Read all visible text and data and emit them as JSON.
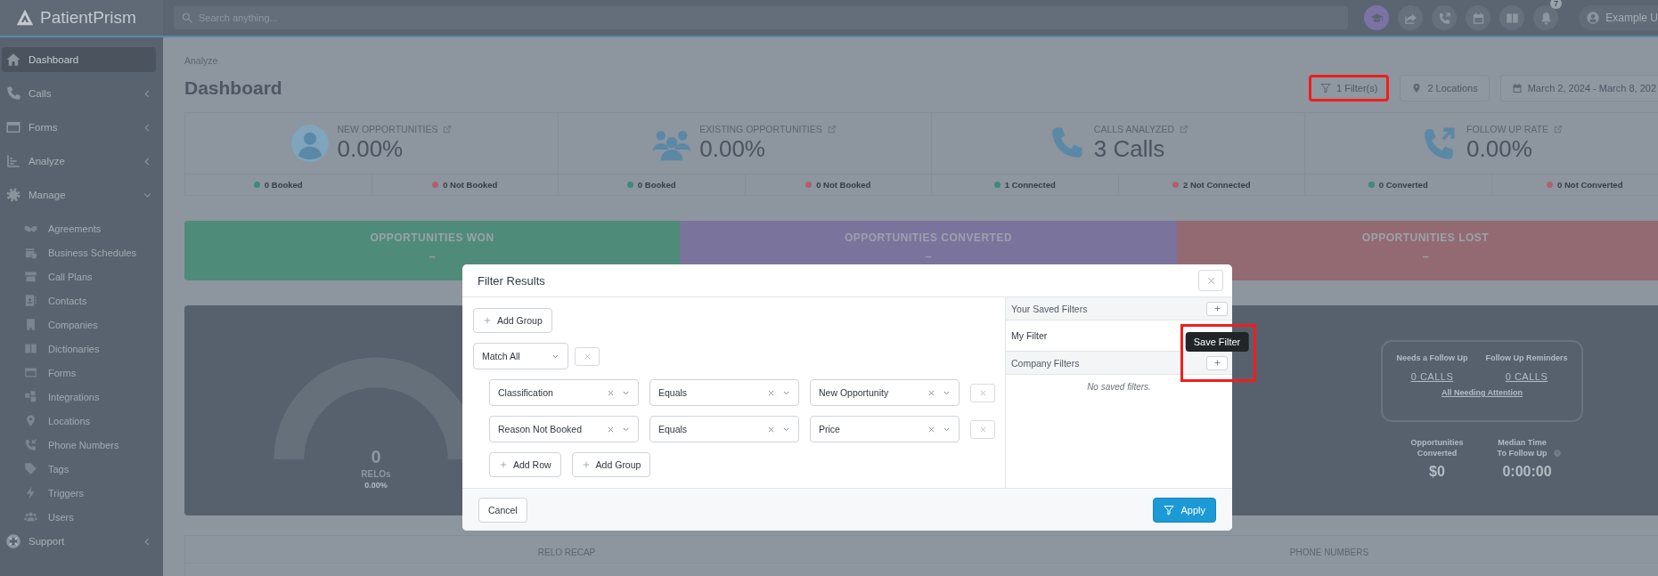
{
  "logo": "**Patient**Prism",
  "top_bar": {
    "search_placeholder": "Search anything...",
    "notification_count": "7",
    "user": "Example U"
  },
  "sidebar": {
    "items": [
      {
        "label": "Dashboard",
        "selected": true
      },
      {
        "label": "Calls",
        "selected": false,
        "expanded": false
      },
      {
        "label": "Forms",
        "selected": false,
        "expanded": false
      },
      {
        "label": "Analyze",
        "selected": false,
        "expanded": false
      },
      {
        "label": "Manage",
        "selected": false,
        "expanded": true,
        "children": [
          {
            "label": "Agreements",
            "selected": false
          },
          {
            "label": "Business Schedules",
            "selected": false
          },
          {
            "label": "Call Plans",
            "selected": false
          },
          {
            "label": "Contacts",
            "selected": false
          },
          {
            "label": "Companies",
            "selected": false
          },
          {
            "label": "Dictionaries",
            "selected": false
          },
          {
            "label": "Forms",
            "selected": false
          },
          {
            "label": "Integrations",
            "selected": false
          },
          {
            "label": "Locations",
            "selected": false
          },
          {
            "label": "Phone Numbers",
            "selected": false
          },
          {
            "label": "Tags",
            "selected": false
          },
          {
            "label": "Triggers",
            "selected": false
          },
          {
            "label": "Users",
            "selected": false
          }
        ]
      },
      {
        "label": "Support",
        "selected": false,
        "expanded": false
      }
    ]
  },
  "page": {
    "breadcrumb": "Analyze",
    "title": "Dashboard",
    "toolbar": [
      {
        "label": "1 Filter(s)",
        "highlighted": true
      },
      {
        "label": "2 Locations",
        "highlighted": false
      },
      {
        "label": "March 2, 2024 - March 8, 202",
        "highlighted": false
      }
    ]
  },
  "stats": [
    {
      "title": "NEW OPPORTUNITIES",
      "value": "0.00%",
      "footer": [
        {
          "label": "0 Booked",
          "color": "#3f8a76"
        },
        {
          "label": "0 Not Booked",
          "color": "#b0606b"
        }
      ]
    },
    {
      "title": "EXISTING OPPORTUNITIES",
      "value": "0.00%",
      "footer": [
        {
          "label": "0 Booked",
          "color": "#3f8a76"
        },
        {
          "label": "0 Not Booked",
          "color": "#b0606b"
        }
      ]
    },
    {
      "title": "CALLS ANALYZED",
      "value": "3 Calls",
      "footer": [
        {
          "label": "1 Connected",
          "color": "#3f8a76"
        },
        {
          "label": "2 Not Connected",
          "color": "#b0606b"
        }
      ]
    },
    {
      "title": "FOLLOW UP RATE",
      "value": "0.00%",
      "footer": [
        {
          "label": "0 Converted",
          "color": "#3f8a76"
        },
        {
          "label": "0 Not Converted",
          "color": "#b0606b"
        }
      ]
    }
  ],
  "banners": [
    {
      "title": "OPPORTUNITIES WON",
      "value": "–",
      "color": "#4f8b79"
    },
    {
      "title": "OPPORTUNITIES CONVERTED",
      "value": "–",
      "color": "#7a739c"
    },
    {
      "title": "OPPORTUNITIES LOST",
      "value": "–",
      "color": "#946a72"
    }
  ],
  "relos": {
    "value": "0",
    "label": "RELOs",
    "percent": "0.00%"
  },
  "follow_up": {
    "columns": [
      {
        "label": "Needs a Follow Up",
        "value": "0 CALLS"
      },
      {
        "label": "Follow Up Reminders",
        "value": "0 CALLS"
      }
    ],
    "link": "All Needing Attention",
    "metrics": [
      {
        "label": "Opportunities Converted",
        "value": "$0"
      },
      {
        "label": "Median Time To Follow Up",
        "value": "0:00:00"
      }
    ]
  },
  "sections": [
    "RELO RECAP",
    "PHONE NUMBERS"
  ],
  "modal": {
    "title": "Filter Results",
    "add_group": "Add Group",
    "match": "Match All",
    "rules": [
      {
        "field": "Classification",
        "operator": "Equals",
        "value": "New Opportunity"
      },
      {
        "field": "Reason Not Booked",
        "operator": "Equals",
        "value": "Price"
      }
    ],
    "add_row": "Add Row",
    "add_group_inner": "Add Group",
    "saved": {
      "title": "Your Saved Filters",
      "items": [
        {
          "label": "My Filter"
        }
      ]
    },
    "company": {
      "title": "Company Filters",
      "empty": "No saved filters.",
      "tooltip": "Save Filter",
      "highlighted": true
    },
    "cancel": "Cancel",
    "apply": "Apply"
  }
}
